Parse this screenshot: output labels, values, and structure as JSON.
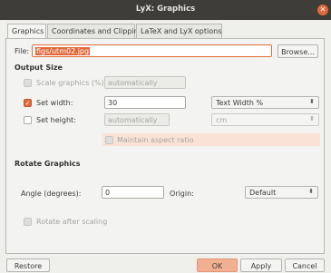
{
  "window": {
    "title": "LyX: Graphics"
  },
  "tabs": [
    {
      "label": "Graphics",
      "active": true
    },
    {
      "label": "Coordinates and Clipping",
      "active": false
    },
    {
      "label": "LaTeX and LyX options",
      "active": false
    }
  ],
  "file": {
    "label": "File:",
    "value": "figs/utm02.jpg",
    "browse_label": "Browse..."
  },
  "output_size": {
    "heading": "Output Size",
    "scale": {
      "label": "Scale graphics (%):",
      "checked": false,
      "enabled": false,
      "value": "automatically"
    },
    "width": {
      "label": "Set width:",
      "checked": true,
      "value": "30",
      "unit": "Text Width %"
    },
    "height": {
      "label": "Set height:",
      "checked": false,
      "value": "automatically",
      "unit": "cm"
    },
    "maintain": {
      "label": "Maintain aspect ratio",
      "checked": false,
      "enabled": false
    }
  },
  "rotate": {
    "heading": "Rotate Graphics",
    "angle_label": "Angle (degrees):",
    "angle_value": "0",
    "origin_label": "Origin:",
    "origin_value": "Default",
    "rotate_after_label": "Rotate after scaling",
    "rotate_after_enabled": false
  },
  "buttons": {
    "restore": "Restore",
    "ok": "OK",
    "apply": "Apply",
    "cancel": "Cancel"
  },
  "icons": {
    "close": "close-icon",
    "check": "checkmark-icon",
    "dropdown": "chevron-updown-icon"
  },
  "colors": {
    "accent": "#e0693b",
    "titlebar": "#3e3d38"
  }
}
